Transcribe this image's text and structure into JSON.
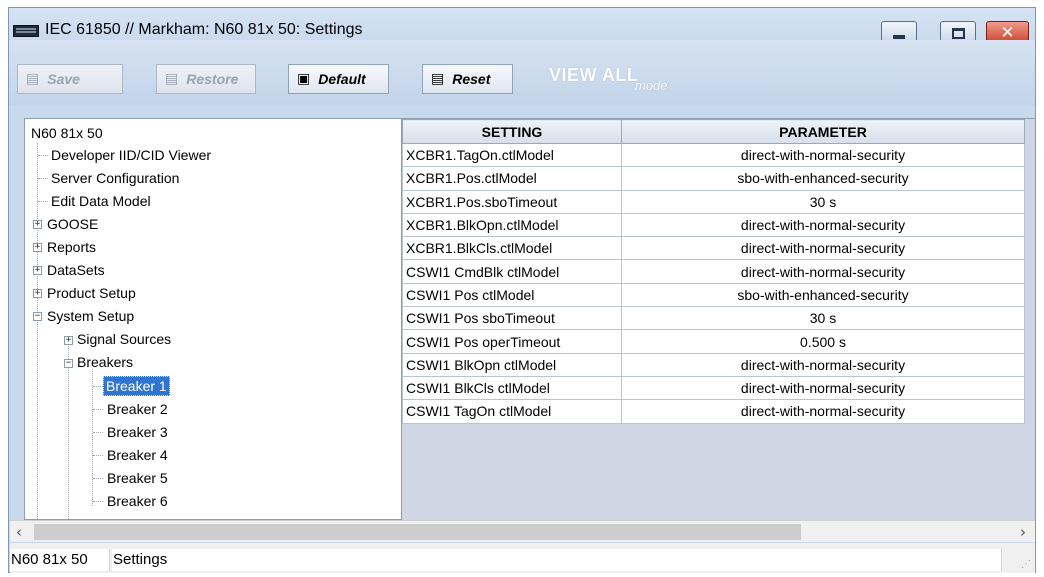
{
  "window": {
    "title": "IEC 61850 // Markham: N60 81x 50: Settings",
    "colors": {
      "titlebar": "#c9d9ec",
      "selection": "#3074d0",
      "close": "#c7412a"
    }
  },
  "toolbar": {
    "save_label": "Save",
    "restore_label": "Restore",
    "default_label": "Default",
    "reset_label": "Reset",
    "viewall_label": "VIEW ALL",
    "viewall_mode": "mode"
  },
  "tree": {
    "root": "N60 81x 50",
    "items": [
      {
        "label": "Developer IID/CID Viewer"
      },
      {
        "label": "Server Configuration"
      },
      {
        "label": "Edit Data Model"
      },
      {
        "label": "GOOSE"
      },
      {
        "label": "Reports"
      },
      {
        "label": "DataSets"
      },
      {
        "label": "Product Setup"
      },
      {
        "label": "System Setup"
      },
      {
        "label": "Signal Sources"
      },
      {
        "label": "Breakers"
      },
      {
        "label": "Breaker 1"
      },
      {
        "label": "Breaker 2"
      },
      {
        "label": "Breaker 3"
      },
      {
        "label": "Breaker 4"
      },
      {
        "label": "Breaker 5"
      },
      {
        "label": "Breaker 6"
      }
    ]
  },
  "table": {
    "headers": {
      "setting": "SETTING",
      "parameter": "PARAMETER"
    },
    "rows": [
      {
        "setting": "XCBR1.TagOn.ctlModel",
        "parameter": "direct-with-normal-security"
      },
      {
        "setting": "XCBR1.Pos.ctlModel",
        "parameter": "sbo-with-enhanced-security"
      },
      {
        "setting": "XCBR1.Pos.sboTimeout",
        "parameter": "30 s"
      },
      {
        "setting": "XCBR1.BlkOpn.ctlModel",
        "parameter": "direct-with-normal-security"
      },
      {
        "setting": "XCBR1.BlkCls.ctlModel",
        "parameter": "direct-with-normal-security"
      },
      {
        "setting": "CSWI1 CmdBlk ctlModel",
        "parameter": "direct-with-normal-security"
      },
      {
        "setting": "CSWI1 Pos ctlModel",
        "parameter": "sbo-with-enhanced-security"
      },
      {
        "setting": "CSWI1 Pos sboTimeout",
        "parameter": "30 s"
      },
      {
        "setting": "CSWI1 Pos operTimeout",
        "parameter": "0.500 s"
      },
      {
        "setting": "CSWI1 BlkOpn ctlModel",
        "parameter": "direct-with-normal-security"
      },
      {
        "setting": "CSWI1 BlkCls ctlModel",
        "parameter": "direct-with-normal-security"
      },
      {
        "setting": "CSWI1 TagOn ctlModel",
        "parameter": "direct-with-normal-security"
      }
    ]
  },
  "status": {
    "device": "N60 81x 50",
    "page": "Settings"
  }
}
